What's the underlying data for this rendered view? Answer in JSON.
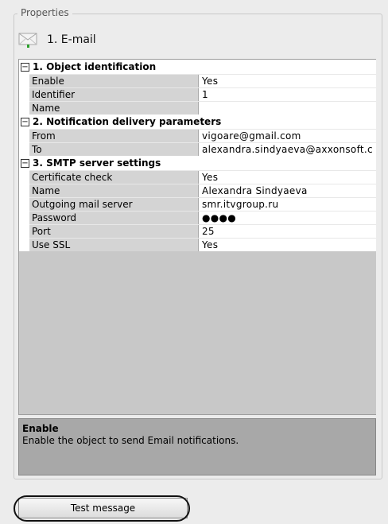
{
  "panel": {
    "legend": "Properties",
    "object_title": "1. E-mail",
    "object_icon": "envelope-icon"
  },
  "grid": {
    "sections": [
      {
        "title": "1. Object identification",
        "rows": [
          {
            "name": "Enable",
            "value": "Yes"
          },
          {
            "name": "Identifier",
            "value": "1"
          },
          {
            "name": "Name",
            "value": ""
          }
        ]
      },
      {
        "title": "2. Notification delivery parameters",
        "rows": [
          {
            "name": "From",
            "value": "vigoare@gmail.com"
          },
          {
            "name": "To",
            "value": "alexandra.sindyaeva@axxonsoft.c"
          }
        ]
      },
      {
        "title": "3. SMTP server settings",
        "rows": [
          {
            "name": "Certificate check",
            "value": "Yes"
          },
          {
            "name": "Name",
            "value": "Alexandra Sindyaeva"
          },
          {
            "name": "Outgoing mail server",
            "value": "smr.itvgroup.ru"
          },
          {
            "name": "Password",
            "value": "●●●●"
          },
          {
            "name": "Port",
            "value": "25"
          },
          {
            "name": "Use SSL",
            "value": "Yes"
          }
        ]
      }
    ]
  },
  "description": {
    "title": "Enable",
    "text": "Enable the object to send Email notifications."
  },
  "footer": {
    "test_button_label": "Test message"
  },
  "colors": {
    "background": "#ececec",
    "name_cell": "#d4d4d4",
    "grid_empty": "#c8c8c8",
    "description_bg": "#a8a8a8"
  }
}
